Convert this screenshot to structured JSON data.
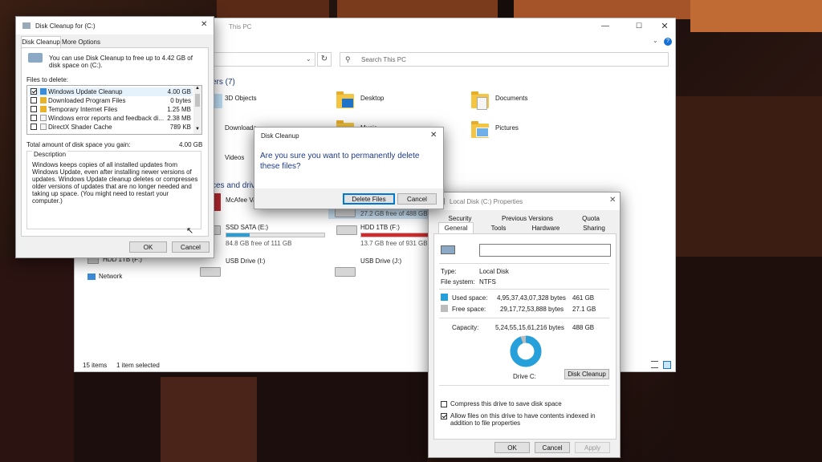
{
  "explorer": {
    "title": "This PC",
    "search_placeholder": "Search This PC",
    "group_folders": "ers (7)",
    "group_devices": "ces and driv",
    "folders": [
      "3D Objects",
      "Desktop",
      "Documents",
      "Downloads",
      "Music",
      "Pictures",
      "Videos"
    ],
    "drives": [
      {
        "name": "McAfee Va",
        "free": ""
      },
      {
        "name": "",
        "free": "27.2 GB free of 488 GB"
      },
      {
        "name": "SSD SATA (E:)",
        "free": "84.8 GB free of 111 GB"
      },
      {
        "name": "HDD 1TB (F:)",
        "free": "13.7 GB free of 931 GB"
      },
      {
        "name": "USB Drive (I:)",
        "free": ""
      },
      {
        "name": "USB Drive (J:)",
        "free": ""
      }
    ],
    "nav": {
      "hdd": "HDD 1TB (F:)",
      "network": "Network"
    },
    "status": {
      "items": "15 items",
      "selected": "1 item selected"
    }
  },
  "disk_cleanup_main": {
    "title": "Disk Cleanup for  (C:)",
    "tabs": [
      "Disk Cleanup",
      "More Options"
    ],
    "intro": "You can use Disk Cleanup to free up to 4.42 GB of disk space on  (C:).",
    "files_label": "Files to delete:",
    "files": [
      {
        "name": "Windows Update Cleanup",
        "size": "4.00 GB",
        "checked": true
      },
      {
        "name": "Downloaded Program Files",
        "size": "0 bytes",
        "checked": false
      },
      {
        "name": "Temporary Internet Files",
        "size": "1.25 MB",
        "checked": false
      },
      {
        "name": "Windows error reports and feedback di...",
        "size": "2.38 MB",
        "checked": false
      },
      {
        "name": "DirectX Shader Cache",
        "size": "789 KB",
        "checked": false
      }
    ],
    "total_label": "Total amount of disk space you gain:",
    "total_value": "4.00 GB",
    "description_label": "Description",
    "description": "Windows keeps copies of all installed updates from Windows Update, even after installing newer versions of updates. Windows Update cleanup deletes or compresses older versions of updates that are no longer needed and taking up space. (You might need to restart your computer.)",
    "ok": "OK",
    "cancel": "Cancel"
  },
  "confirm_dialog": {
    "title": "Disk Cleanup",
    "message": "Are you sure you want to permanently delete these files?",
    "delete": "Delete Files",
    "cancel": "Cancel"
  },
  "properties": {
    "title": "Local Disk (C:) Properties",
    "tabs_top": [
      "Security",
      "Previous Versions",
      "Quota"
    ],
    "tabs_bottom": [
      "General",
      "Tools",
      "Hardware",
      "Sharing"
    ],
    "name_value": "",
    "type_label": "Type:",
    "type_value": "Local Disk",
    "fs_label": "File system:",
    "fs_value": "NTFS",
    "used_label": "Used space:",
    "used_bytes": "4,95,37,43,07,328 bytes",
    "used_gb": "461 GB",
    "free_label": "Free space:",
    "free_bytes": "29,17,72,53,888 bytes",
    "free_gb": "27.1 GB",
    "capacity_label": "Capacity:",
    "capacity_bytes": "5,24,55,15,61,216 bytes",
    "capacity_gb": "488 GB",
    "drive_label": "Drive C:",
    "cleanup_button": "Disk Cleanup",
    "compress_label": "Compress this drive to save disk space",
    "index_label": "Allow files on this drive to have contents indexed in addition to file properties",
    "ok": "OK",
    "cancel": "Cancel",
    "apply": "Apply",
    "used_color": "#26a0da",
    "free_color": "#bcbcbc"
  }
}
